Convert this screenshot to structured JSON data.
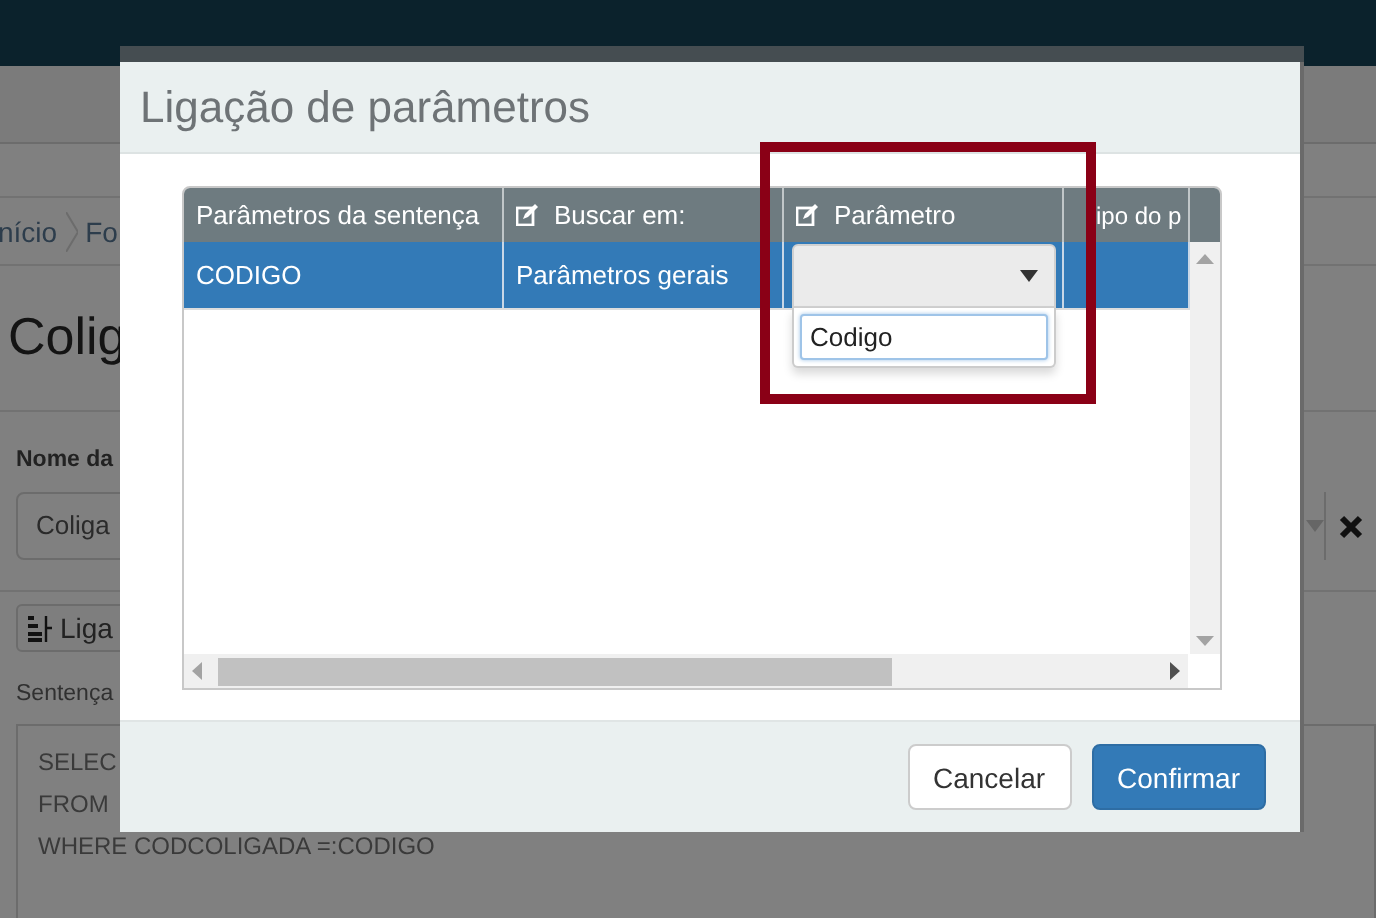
{
  "background_page": {
    "breadcrumb": [
      "nício",
      "Fo"
    ],
    "title": "Colig",
    "name_label": "Nome da",
    "name_field": {
      "value": "Coliga"
    },
    "link_button": {
      "label": "Liga"
    },
    "sentence_label": "Sentença",
    "sentence_lines": [
      "SELEC",
      "FROM",
      "WHERE CODCOLIGADA =:CODIGO"
    ]
  },
  "dialog": {
    "title": "Ligação de parâmetros",
    "table": {
      "columns": [
        {
          "label": "Parâmetros da sentença",
          "editable": false
        },
        {
          "label": "Buscar em:",
          "editable": true
        },
        {
          "label": "Parâmetro",
          "editable": true
        },
        {
          "label": "ipo do p",
          "editable": false
        }
      ],
      "rows": [
        {
          "selected": true,
          "cells": [
            {
              "kind": "text",
              "text": "CODIGO"
            },
            {
              "kind": "text",
              "text": "Parâmetros gerais"
            },
            {
              "kind": "select",
              "expanded": true,
              "search_value": "Codigo"
            },
            {
              "kind": "empty"
            }
          ]
        }
      ]
    },
    "buttons": [
      {
        "label": "Cancelar",
        "kind": "default"
      },
      {
        "label": "Confirmar",
        "kind": "primary"
      }
    ]
  }
}
